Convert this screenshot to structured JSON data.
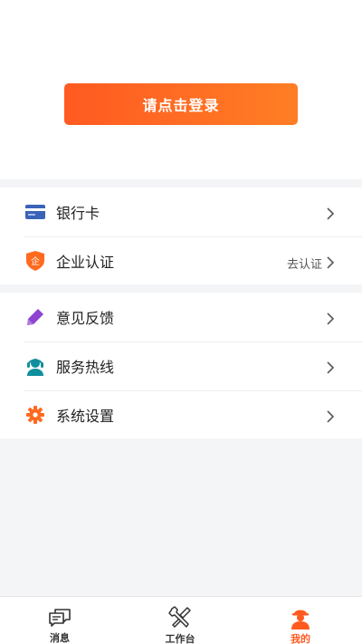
{
  "header": {
    "login_label": "请点击登录"
  },
  "menu_group_1": [
    {
      "label": "银行卡",
      "right_text": "",
      "icon": "bank-card-icon"
    },
    {
      "label": "企业认证",
      "right_text": "去认证",
      "icon": "enterprise-shield-icon"
    }
  ],
  "menu_group_2": [
    {
      "label": "意见反馈",
      "right_text": "",
      "icon": "pencil-icon"
    },
    {
      "label": "服务热线",
      "right_text": "",
      "icon": "customer-service-icon"
    },
    {
      "label": "系统设置",
      "right_text": "",
      "icon": "gear-icon"
    }
  ],
  "enterprise_badge_char": "企",
  "tabbar": {
    "messages": "消息",
    "workbench": "工作台",
    "mine": "我的"
  },
  "colors": {
    "accent": "#ff5a1f",
    "bank_card": "#3b63b8",
    "shield": "#ff6a1f",
    "pencil": "#8e44d1",
    "service": "#0f8f9e",
    "gear": "#ff6a1f"
  }
}
